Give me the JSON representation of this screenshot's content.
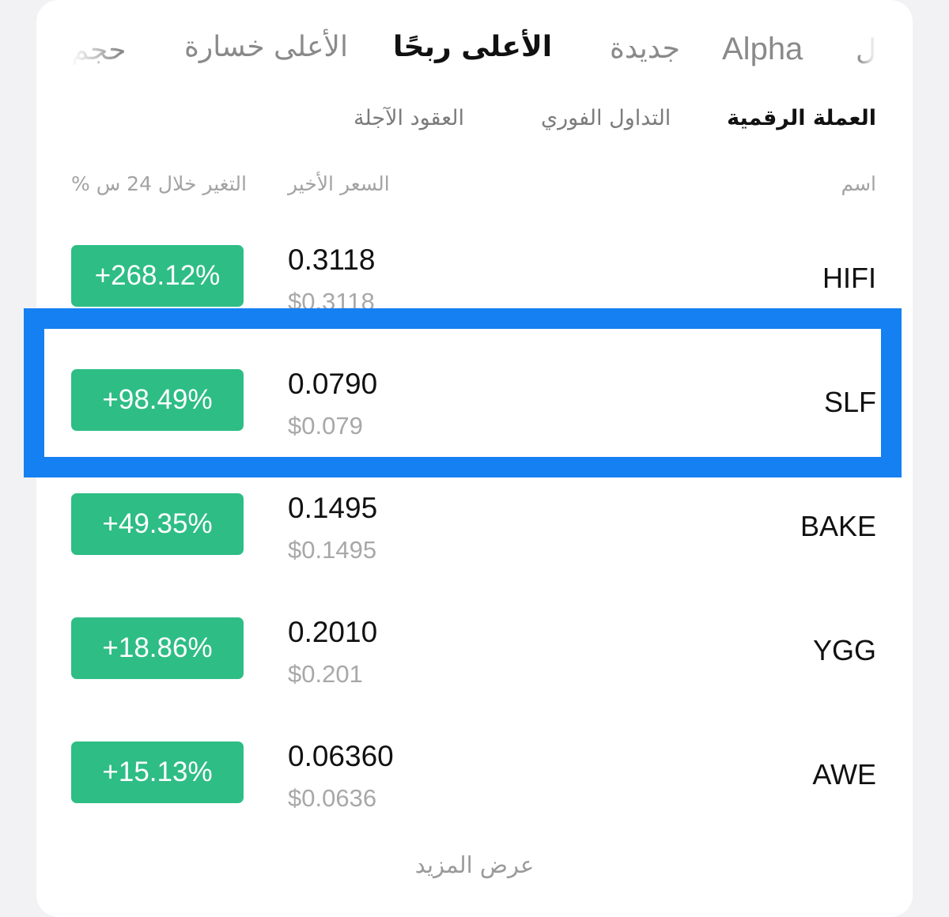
{
  "top_tabs": [
    {
      "label": "حجم",
      "active": false
    },
    {
      "label": "الأعلى خسارة",
      "active": false
    },
    {
      "label": "الأعلى ربحًا",
      "active": true
    },
    {
      "label": "جديدة",
      "active": false
    },
    {
      "label": "Alpha",
      "active": false
    },
    {
      "label": "ل",
      "active": false
    }
  ],
  "sub_tabs": [
    {
      "label": "العقود الآجلة",
      "active": false
    },
    {
      "label": "التداول الفوري",
      "active": false
    },
    {
      "label": "العملة الرقمية",
      "active": true
    }
  ],
  "columns": {
    "change": "% التغير خلال 24 س",
    "last_price": "السعر الأخير",
    "name": "اسم"
  },
  "rows": [
    {
      "symbol": "HIFI",
      "price": "0.3118",
      "usd": "$0.3118",
      "change": "+268.12%"
    },
    {
      "symbol": "SLF",
      "price": "0.0790",
      "usd": "$0.079",
      "change": "+98.49%"
    },
    {
      "symbol": "BAKE",
      "price": "0.1495",
      "usd": "$0.1495",
      "change": "+49.35%"
    },
    {
      "symbol": "YGG",
      "price": "0.2010",
      "usd": "$0.201",
      "change": "+18.86%"
    },
    {
      "symbol": "AWE",
      "price": "0.06360",
      "usd": "$0.0636",
      "change": "+15.13%"
    }
  ],
  "highlighted_row": "SLF",
  "show_more": "عرض المزيد",
  "colors": {
    "positive": "#2ebd85",
    "highlight": "#1480f2",
    "text_primary": "#111111",
    "text_secondary": "#a8a8a8"
  }
}
